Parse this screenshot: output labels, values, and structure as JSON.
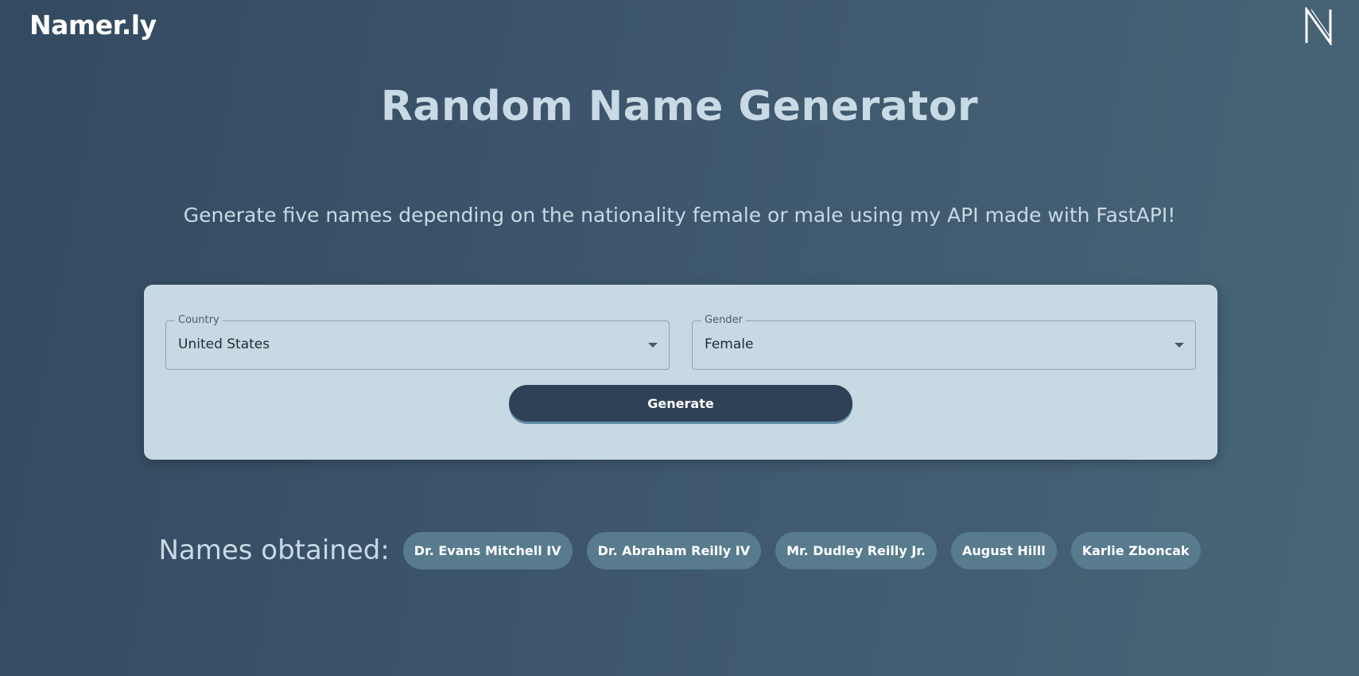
{
  "header": {
    "brand": "Namer.ly",
    "logo_icon": "n-monogram-icon"
  },
  "hero": {
    "title": "Random Name Generator",
    "subtitle": "Generate five names depending on the nationality female or male using my API made with FastAPI!"
  },
  "form": {
    "country": {
      "label": "Country",
      "value": "United States"
    },
    "gender": {
      "label": "Gender",
      "value": "Female"
    },
    "generate_label": "Generate"
  },
  "results": {
    "label": "Names obtained:",
    "names": [
      "Dr. Evans Mitchell IV",
      "Dr. Abraham Reilly IV",
      "Mr. Dudley Reilly Jr.",
      "August Hilll",
      "Karlie Zboncak"
    ]
  },
  "colors": {
    "background_start": "#334a60",
    "background_end": "#486577",
    "card": "#c7dae4",
    "button": "#2f4157",
    "chip": "#587b8e",
    "heading_text": "#c8dae5"
  }
}
